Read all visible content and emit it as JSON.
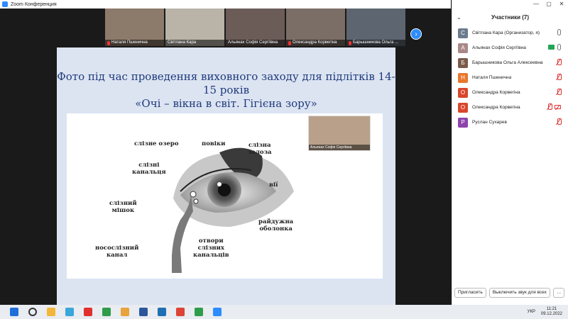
{
  "window": {
    "title": "Zoom Конференция"
  },
  "thumbnails": [
    {
      "name": "Наталя Пшенична",
      "muted": true,
      "bg": "#8c7a6b"
    },
    {
      "name": "Світлана Кара",
      "muted": false,
      "bg": "#b9b3a8"
    },
    {
      "name": "Альянах Софія Сергіївна",
      "muted": false,
      "bg": "#6c5c58"
    },
    {
      "name": "Олександра Корвегіна",
      "muted": true,
      "bg": "#7b6e66"
    },
    {
      "name": "Барышникова Ольга ...",
      "muted": true,
      "bg": "#5d6670"
    }
  ],
  "thumb_next_icon": "›",
  "slide": {
    "title_line1": "Фото під час проведення виховного заходу для підлітків 14-15 років",
    "title_line2": "«Очі – вікна в світ. Гігієна зору»",
    "labels": {
      "lake": "слізне озеро",
      "eyelids": "повіки",
      "gland": "слізна\nзалоза",
      "canaliculi": "слізні\nканальця",
      "lashes": "вії",
      "sac": "слізний\nмішок",
      "iris": "райдужна\nоболонка",
      "nasolacrimal": "носослізний\nканал",
      "openings": "отвори\nслізних\nканальців"
    }
  },
  "self_view": {
    "name": "Альянах Софія Сергіївна"
  },
  "panel": {
    "title": "Участники (7)",
    "collapse_icon": "⌄",
    "win_minimize": "—",
    "win_maximize": "▢",
    "win_close": "✕",
    "participants": [
      {
        "initial": "С",
        "name": "Світлана Кара (Организатор, я)",
        "color": "#6b7b8c",
        "mic": "on",
        "cam": "none",
        "share": false
      },
      {
        "initial": "А",
        "name": "Альянах Софія Сергіївна",
        "color": "#a88",
        "mic": "on",
        "cam": "none",
        "share": true
      },
      {
        "initial": "Б",
        "name": "Барышникова Ольга Алексеевна",
        "color": "#7a5a4a",
        "mic": "off",
        "cam": "none",
        "share": false
      },
      {
        "initial": "Н",
        "name": "Наталя Пшенична",
        "color": "#e8772e",
        "mic": "off",
        "cam": "none",
        "share": false
      },
      {
        "initial": "О",
        "name": "Олександра Корвегіна",
        "color": "#d9472b",
        "mic": "off",
        "cam": "none",
        "share": false
      },
      {
        "initial": "О",
        "name": "Олександра Корвегіна",
        "color": "#d9472b",
        "mic": "off",
        "cam": "off",
        "share": false
      },
      {
        "initial": "Р",
        "name": "Руслан Сухарев",
        "color": "#8e44ad",
        "mic": "off",
        "cam": "none",
        "share": false
      }
    ],
    "invite_label": "Пригласить",
    "mute_all_label": "Выключить звук для всех",
    "more_label": "…"
  },
  "taskbar": {
    "language": "УКР",
    "time": "11:21",
    "date": "09.12.2022",
    "icons": [
      "windows-start",
      "search",
      "explorer",
      "paint",
      "opera",
      "chrome",
      "files",
      "word",
      "defender",
      "chrome-profile",
      "chrome-2",
      "zoom"
    ]
  }
}
